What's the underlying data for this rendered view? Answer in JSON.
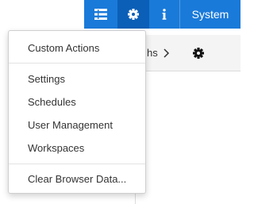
{
  "topbar": {
    "system_label": "System",
    "icons": {
      "panel": "panel-list-icon",
      "settings": "gear-icon",
      "info": "info-icon"
    },
    "colors": {
      "bar": "#1a7ad9",
      "active": "#0b5fb7"
    }
  },
  "background": {
    "breadcrumb_fragment": "hs",
    "settings_icon": "gear-icon"
  },
  "settings_menu": {
    "items": [
      {
        "label": "Custom Actions"
      },
      {
        "label": "Settings"
      },
      {
        "label": "Schedules"
      },
      {
        "label": "User Management"
      },
      {
        "label": "Workspaces"
      },
      {
        "label": "Clear Browser Data..."
      }
    ]
  }
}
